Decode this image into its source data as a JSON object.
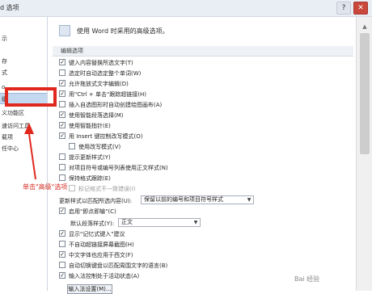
{
  "window": {
    "title": "d 选项",
    "help_label": "?",
    "close_label": "✕"
  },
  "sidebar": {
    "items": [
      {
        "label": "示"
      },
      {
        "label": "存"
      },
      {
        "label": "式"
      },
      {
        "label": "o"
      },
      {
        "label": "级"
      },
      {
        "label": "义功能区"
      },
      {
        "label": "速访问工具"
      },
      {
        "label": "载项"
      },
      {
        "label": "任中心"
      }
    ]
  },
  "annotation": {
    "callout_text": "单击\"高级\"选项"
  },
  "main": {
    "header_text": "使用 Word 时采用的高级选项。",
    "section_editing": "编辑选项",
    "options": [
      {
        "label": "键入内容替换所选文字(T)",
        "checked": "✓"
      },
      {
        "label": "选定时自动选定整个单词(W)",
        "checked": ""
      },
      {
        "label": "允许拖放式文字编辑(D)",
        "checked": "✓"
      },
      {
        "label": "用\"Ctrl + 单击\"跟踪超链接(H)",
        "checked": "✓"
      },
      {
        "label": "插入自选图形时自动创建绘图画布(A)",
        "checked": ""
      },
      {
        "label": "使用智能段落选择(M)",
        "checked": "✓"
      },
      {
        "label": "使用智能指针(E)",
        "checked": "✓"
      },
      {
        "label": "用 Insert 键控制改写模式(O)",
        "checked": "✓"
      },
      {
        "label": "使用改写模式(V)",
        "checked": ""
      },
      {
        "label": "提示更新样式(Y)",
        "checked": ""
      },
      {
        "label": "对项目符号或编号列表使用正文样式(N)",
        "checked": ""
      },
      {
        "label": "保持格式跟踪(E)",
        "checked": ""
      },
      {
        "label": "标记格式不一致错误(I)",
        "checked": ""
      }
    ],
    "update_style_label": "更新样式以匹配所选内容(U):",
    "update_style_value": "保留以前的编号和项目符号样式",
    "click_and_type": {
      "label": "启用\"即点即输\"(C)",
      "checked": "✓"
    },
    "default_para_label": "默认段落样式(Y):",
    "default_para_value": "正文",
    "options2": [
      {
        "label": "显示\"记忆式键入\"建议",
        "checked": "✓"
      },
      {
        "label": "不自动超链接屏幕截图(H)",
        "checked": ""
      },
      {
        "label": "中文字体也应用于西文(F)",
        "checked": "✓"
      },
      {
        "label": "自动切换键盘以匹配周围文字的语言(B)",
        "checked": ""
      },
      {
        "label": "输入法控制处于活动状态(A)",
        "checked": "✓"
      }
    ],
    "ime_settings_button": "输入法设置(M)..."
  },
  "watermark": "Bai 经验"
}
